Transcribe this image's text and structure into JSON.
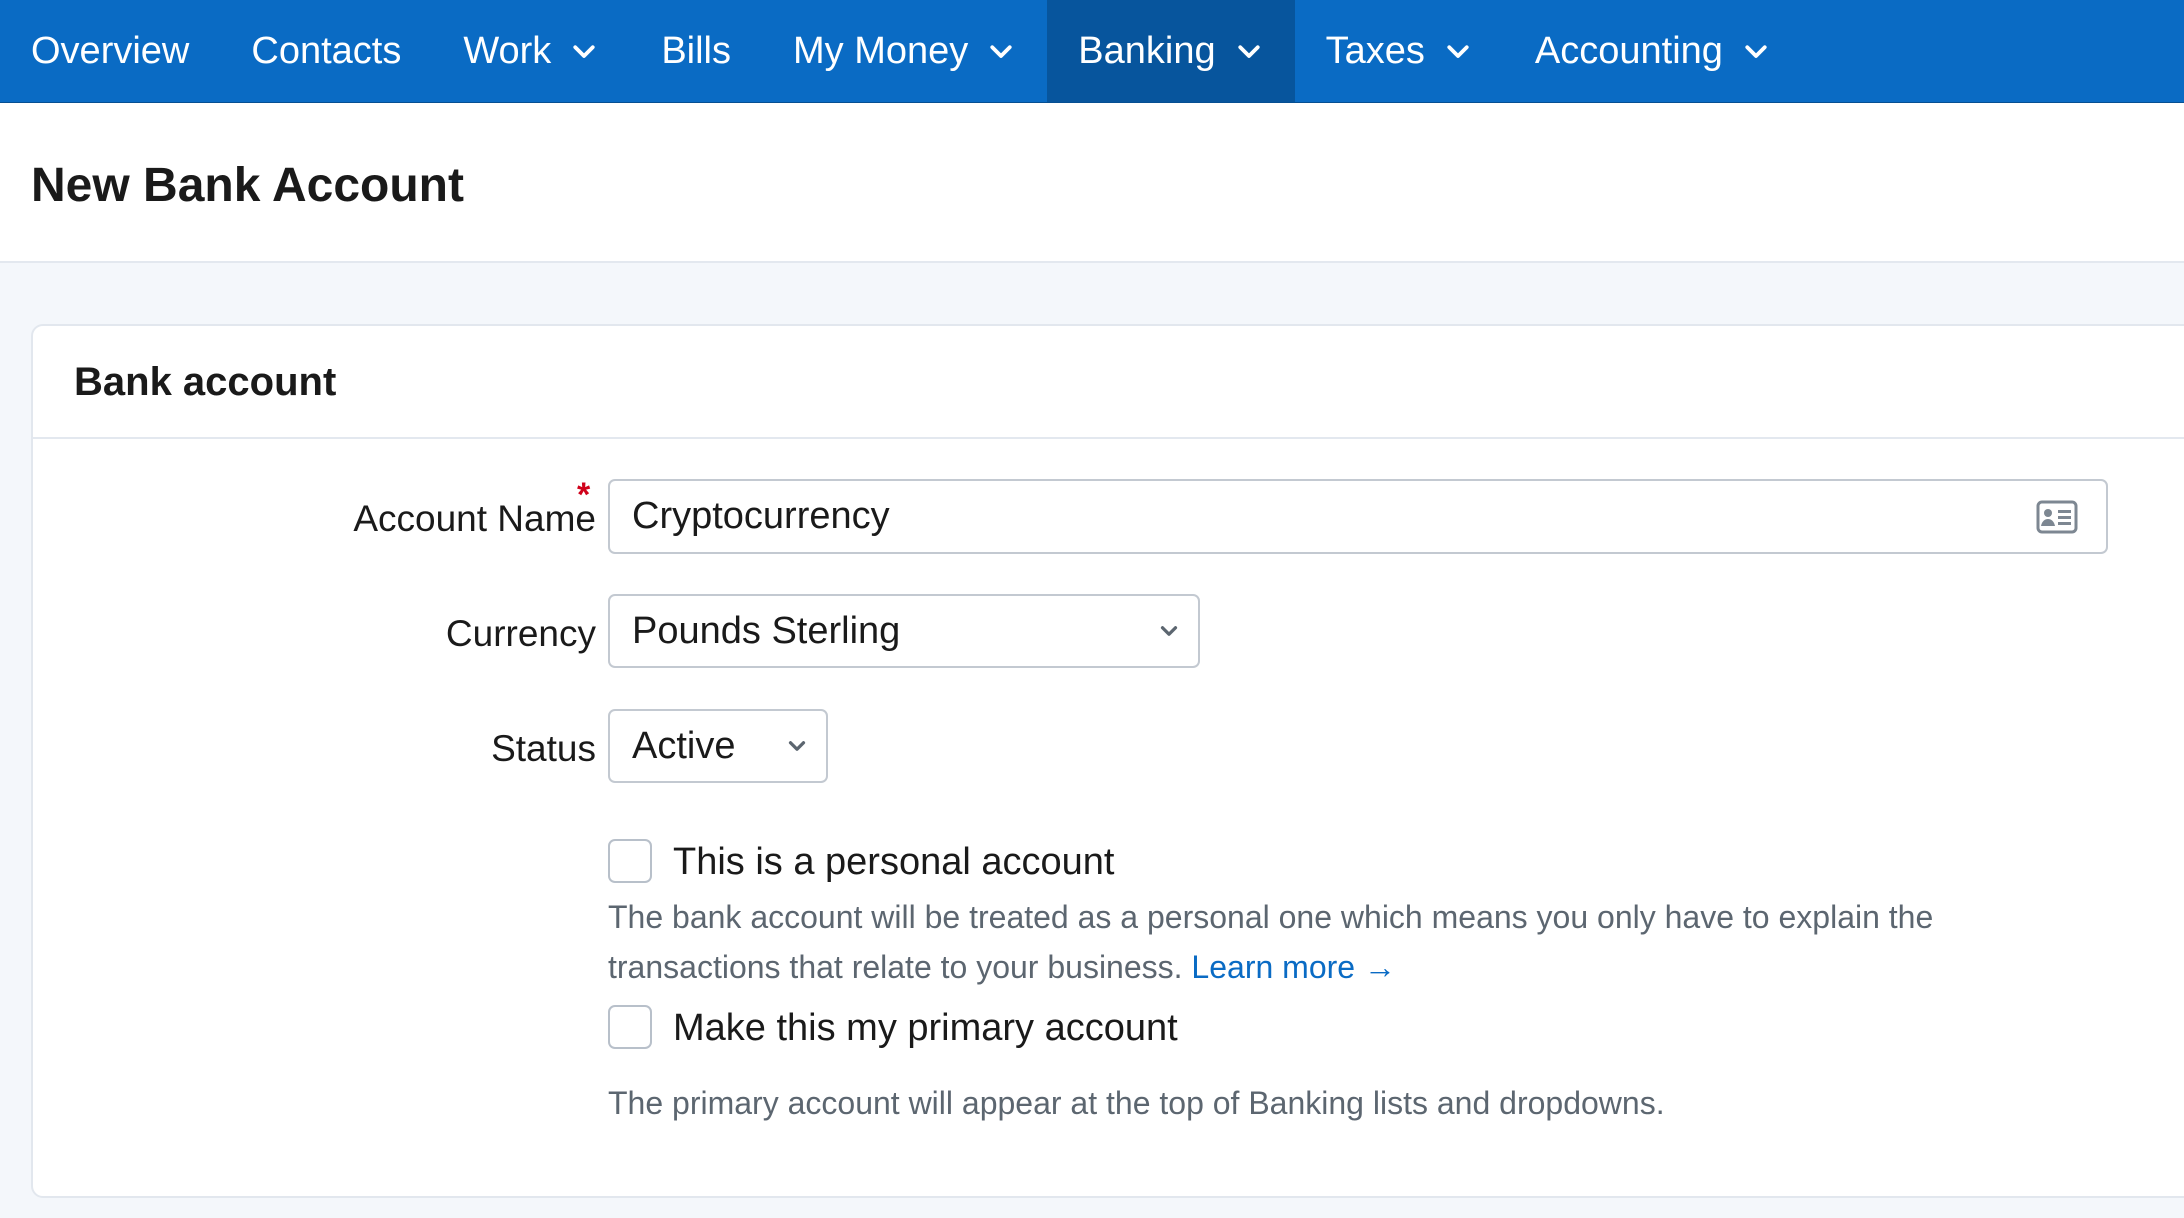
{
  "nav": {
    "items": [
      {
        "label": "Overview",
        "has_dropdown": false,
        "active": false
      },
      {
        "label": "Contacts",
        "has_dropdown": false,
        "active": false
      },
      {
        "label": "Work",
        "has_dropdown": true,
        "active": false
      },
      {
        "label": "Bills",
        "has_dropdown": false,
        "active": false
      },
      {
        "label": "My Money",
        "has_dropdown": true,
        "active": false
      },
      {
        "label": "Banking",
        "has_dropdown": true,
        "active": true
      },
      {
        "label": "Taxes",
        "has_dropdown": true,
        "active": false
      },
      {
        "label": "Accounting",
        "has_dropdown": true,
        "active": false
      }
    ]
  },
  "page": {
    "title": "New Bank Account"
  },
  "card": {
    "title": "Bank account"
  },
  "form": {
    "account_name": {
      "label": "Account Name",
      "required_marker": "*",
      "value": "Cryptocurrency",
      "icon": "contact-card-icon"
    },
    "currency": {
      "label": "Currency",
      "value": "Pounds Sterling"
    },
    "status": {
      "label": "Status",
      "value": "Active"
    },
    "personal": {
      "label": "This is a personal account",
      "checked": false,
      "help": "The bank account will be treated as a personal one which means you only have to explain the transactions that relate to your business.",
      "link": "Learn more →"
    },
    "primary": {
      "label": "Make this my primary account",
      "checked": false,
      "help": "The primary account will appear at the top of Banking lists and dropdowns."
    }
  },
  "colors": {
    "nav_bg": "#0a6bc4",
    "nav_active_bg": "#07559d",
    "link": "#0a6bc4",
    "required": "#d0021b"
  }
}
